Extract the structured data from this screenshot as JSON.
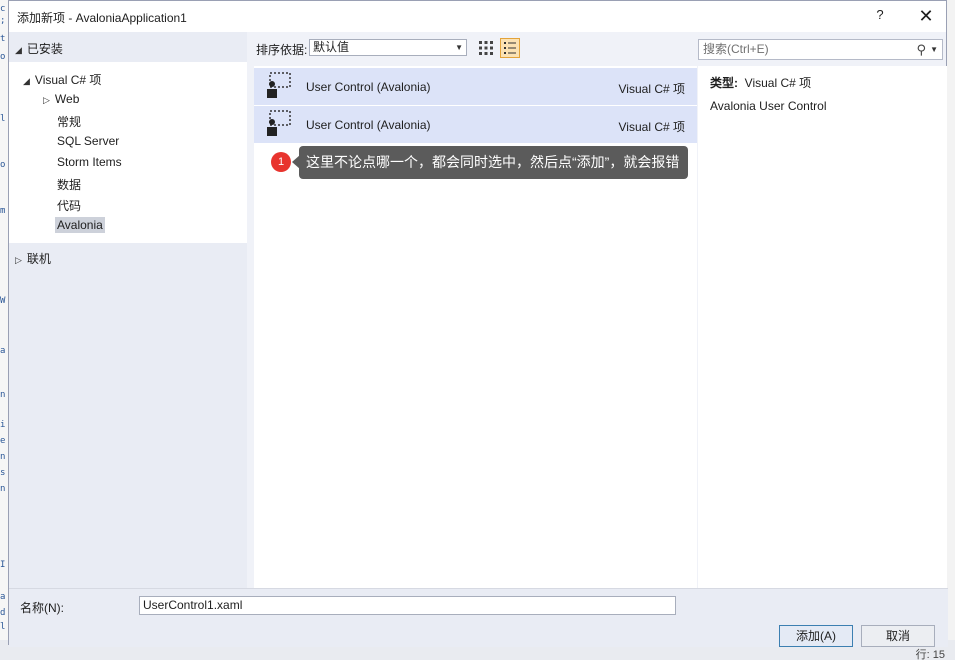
{
  "dialog": {
    "title": "添加新项 - AvaloniaApplication1",
    "help_label": "?",
    "close_label": "✕"
  },
  "left_panel": {
    "installed_label": "已安装",
    "tree": {
      "visual_csharp": "Visual C# 项",
      "web": "Web",
      "general": "常规",
      "sql_server": "SQL Server",
      "storm_items": "Storm Items",
      "data": "数据",
      "code": "代码",
      "avalonia": "Avalonia"
    },
    "online_label": "联机"
  },
  "toolbar": {
    "sort_label": "排序依据:",
    "sort_value": "默认值"
  },
  "search": {
    "placeholder": "搜索(Ctrl+E)"
  },
  "templates": [
    {
      "name": "User Control (Avalonia)",
      "language": "Visual C# 项"
    },
    {
      "name": "User Control (Avalonia)",
      "language": "Visual C# 项"
    }
  ],
  "callout": {
    "number": "1",
    "text": "这里不论点哪一个，都会同时选中，然后点“添加”，就会报错"
  },
  "details": {
    "type_label": "类型:",
    "type_value": "Visual C# 项",
    "description": "Avalonia User Control"
  },
  "bottom": {
    "name_label": "名称(N):",
    "name_value": "UserControl1.xaml",
    "add_button": "添加(A)",
    "cancel_button": "取消"
  },
  "background": {
    "line_indicator": "行: 15"
  },
  "colors": {
    "selection": "#dce3f8",
    "panel": "#e9ecf4",
    "callout_badge": "#e8342e",
    "callout_bg": "#5b5b5b"
  }
}
